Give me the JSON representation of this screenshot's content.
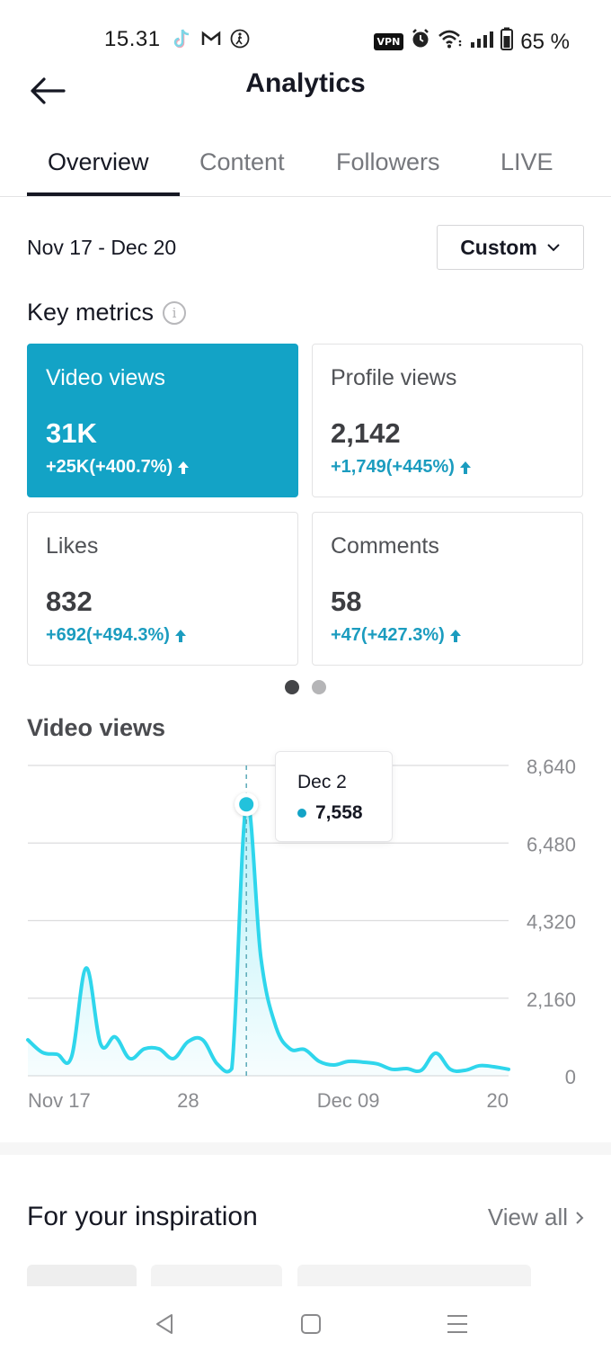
{
  "status_bar": {
    "time": "15.31",
    "left_icons": [
      "tiktok-icon",
      "gmail-icon",
      "accessibility-icon"
    ],
    "vpn_label": "VPN",
    "right_icons": [
      "alarm-icon",
      "wifi-icon",
      "signal-icon",
      "battery-icon"
    ],
    "battery": "65 %"
  },
  "header": {
    "title": "Analytics",
    "back_icon": "arrow-left-icon"
  },
  "tabs": [
    {
      "label": "Overview",
      "active": true
    },
    {
      "label": "Content",
      "active": false
    },
    {
      "label": "Followers",
      "active": false
    },
    {
      "label": "LIVE",
      "active": false
    }
  ],
  "date_filter": {
    "range": "Nov 17 - Dec 20",
    "selector_label": "Custom"
  },
  "key_metrics": {
    "title": "Key metrics",
    "cards": [
      {
        "label": "Video views",
        "value": "31K",
        "delta": "+25K(+400.7%)",
        "active": true
      },
      {
        "label": "Profile views",
        "value": "2,142",
        "delta": "+1,749(+445%)",
        "active": false
      },
      {
        "label": "Likes",
        "value": "832",
        "delta": "+692(+494.3%)",
        "active": false
      },
      {
        "label": "Comments",
        "value": "58",
        "delta": "+47(+427.3%)",
        "active": false
      }
    ],
    "pager": {
      "pages": 2,
      "current": 1
    }
  },
  "colors": {
    "accent": "#13a3c6",
    "line": "#2fd6ec",
    "delta_text": "#1b9cbf"
  },
  "chart_data": {
    "type": "area",
    "title": "Video views",
    "x": [
      "Nov 17",
      "Nov 18",
      "Nov 19",
      "Nov 20",
      "Nov 21",
      "Nov 22",
      "Nov 23",
      "Nov 24",
      "Nov 25",
      "Nov 26",
      "Nov 27",
      "Nov 28",
      "Nov 29",
      "Nov 30",
      "Dec 1",
      "Dec 2",
      "Dec 3",
      "Dec 4",
      "Dec 5",
      "Dec 6",
      "Dec 7",
      "Dec 8",
      "Dec 9",
      "Dec 10",
      "Dec 11",
      "Dec 12",
      "Dec 13",
      "Dec 14",
      "Dec 15",
      "Dec 16",
      "Dec 17",
      "Dec 18",
      "Dec 19",
      "Dec 20"
    ],
    "series": [
      {
        "name": "Video views",
        "values": [
          1000,
          650,
          600,
          530,
          3000,
          880,
          1080,
          480,
          750,
          750,
          480,
          950,
          1000,
          330,
          200,
          7558,
          3280,
          1400,
          750,
          730,
          400,
          300,
          400,
          380,
          330,
          180,
          200,
          150,
          630,
          180,
          150,
          280,
          250,
          180
        ]
      }
    ],
    "x_tick_labels": [
      {
        "label": "Nov 17",
        "index": 0
      },
      {
        "label": "28",
        "index": 11
      },
      {
        "label": "Dec 09",
        "index": 22
      },
      {
        "label": "20",
        "index": 33
      }
    ],
    "y_ticks": [
      0,
      2160,
      4320,
      6480,
      8640
    ],
    "y_tick_labels": [
      "0",
      "2,160",
      "4,320",
      "6,480",
      "8,640"
    ],
    "ylim": [
      0,
      8640
    ],
    "grid": true,
    "legend": "none",
    "xlabel": "",
    "ylabel": "",
    "tooltip": {
      "index": 15,
      "date": "Dec 2",
      "value": "7,558"
    }
  },
  "inspiration": {
    "title": "For your inspiration",
    "view_all_label": "View all"
  },
  "nav_bar": {
    "buttons": [
      "back-nav-icon",
      "home-nav-icon",
      "recents-nav-icon"
    ]
  }
}
